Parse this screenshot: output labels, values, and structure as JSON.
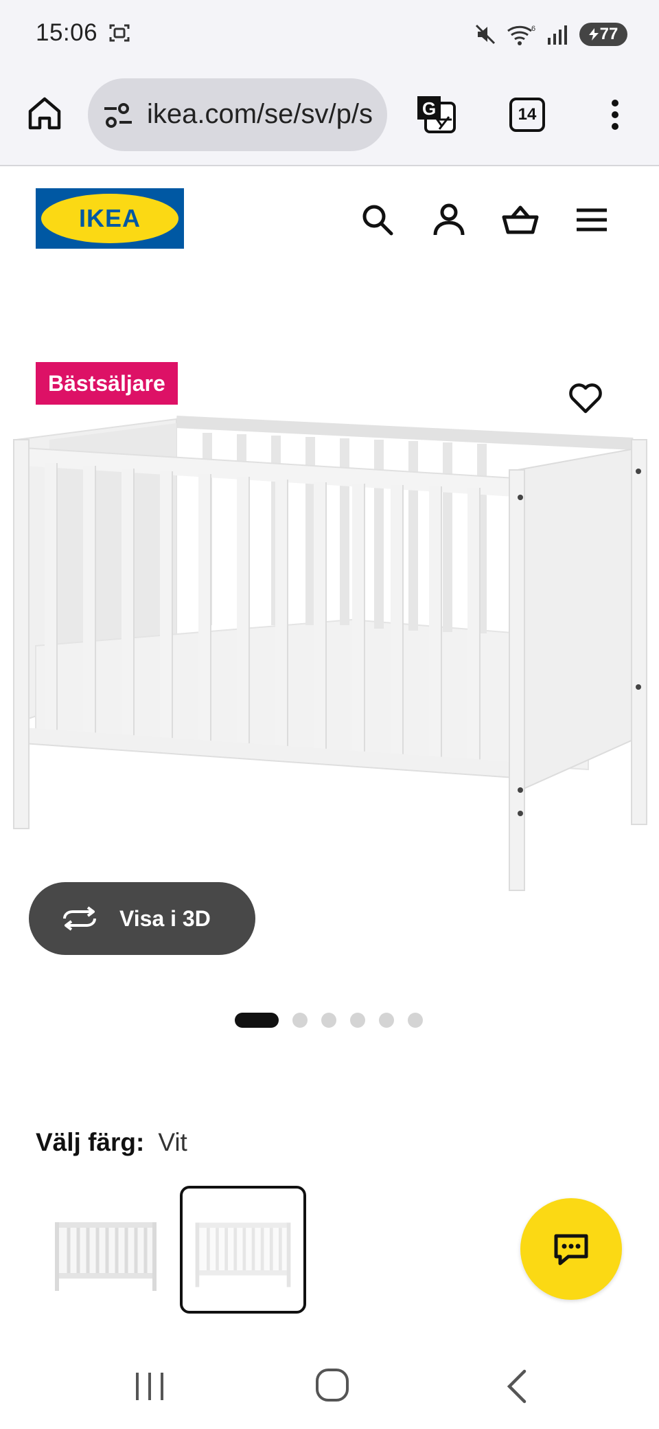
{
  "status_bar": {
    "time": "15:06",
    "battery": "77"
  },
  "browser": {
    "url": "ikea.com/se/sv/p/s",
    "tab_count": "14"
  },
  "site": {
    "logo_text": "IKEA",
    "brand_blue": "#0058a3",
    "brand_yellow": "#fbd914"
  },
  "product": {
    "badge": "Bästsäljare",
    "badge_color": "#dd1166",
    "view_3d_label": "Visa i 3D",
    "image_count": 6,
    "active_image_index": 0
  },
  "color_picker": {
    "label": "Välj färg:",
    "selected": "Vit",
    "selected_index": 1,
    "option_count": 2
  },
  "icons": {
    "header": [
      "search-icon",
      "account-icon",
      "cart-icon",
      "menu-icon"
    ],
    "favourite": "heart-icon",
    "chat": "chat-icon"
  }
}
